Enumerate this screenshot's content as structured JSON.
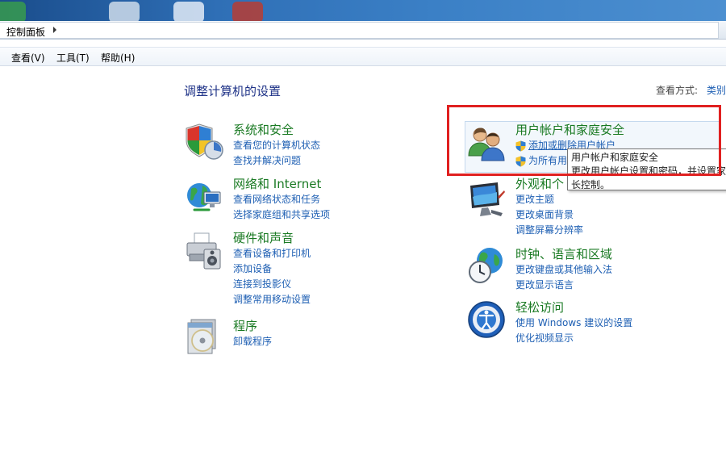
{
  "address_bar": {
    "breadcrumb": "控制面板"
  },
  "menu": {
    "view": "查看(V)",
    "tools": "工具(T)",
    "help": "帮助(H)"
  },
  "page_title": "调整计算机的设置",
  "view_by": {
    "label": "查看方式:",
    "value": "类别"
  },
  "categories": {
    "system_security": {
      "title": "系统和安全",
      "links": [
        "查看您的计算机状态",
        "查找并解决问题"
      ],
      "icon": "shield-icon"
    },
    "network": {
      "title": "网络和 Internet",
      "links": [
        "查看网络状态和任务",
        "选择家庭组和共享选项"
      ],
      "icon": "network-globe-icon"
    },
    "hardware": {
      "title": "硬件和声音",
      "links": [
        "查看设备和打印机",
        "添加设备",
        "连接到投影仪",
        "调整常用移动设置"
      ],
      "icon": "printer-icon"
    },
    "programs": {
      "title": "程序",
      "links": [
        "卸载程序"
      ],
      "icon": "programs-disc-icon"
    },
    "user_accounts": {
      "title": "用户帐户和家庭安全",
      "links": [
        "添加或删除用户帐户",
        "为所有用"
      ],
      "icon": "users-icon"
    },
    "appearance": {
      "title": "外观和个",
      "links": [
        "更改主题",
        "更改桌面背景",
        "调整屏幕分辨率"
      ],
      "icon": "monitor-icon"
    },
    "clock": {
      "title": "时钟、语言和区域",
      "links": [
        "更改键盘或其他输入法",
        "更改显示语言"
      ],
      "icon": "clock-globe-icon"
    },
    "ease": {
      "title": "轻松访问",
      "links": [
        "使用 Windows 建议的设置",
        "优化视频显示"
      ],
      "icon": "accessibility-icon"
    }
  },
  "tooltip": {
    "line1": "用户帐户和家庭安全",
    "line2": "更改用户帐户设置和密码，并设置家",
    "line3": "长控制。"
  },
  "colors": {
    "category_title": "#1a7a23",
    "link": "#1e5fb3",
    "heading": "#1e3287",
    "highlight": "#e02020"
  }
}
